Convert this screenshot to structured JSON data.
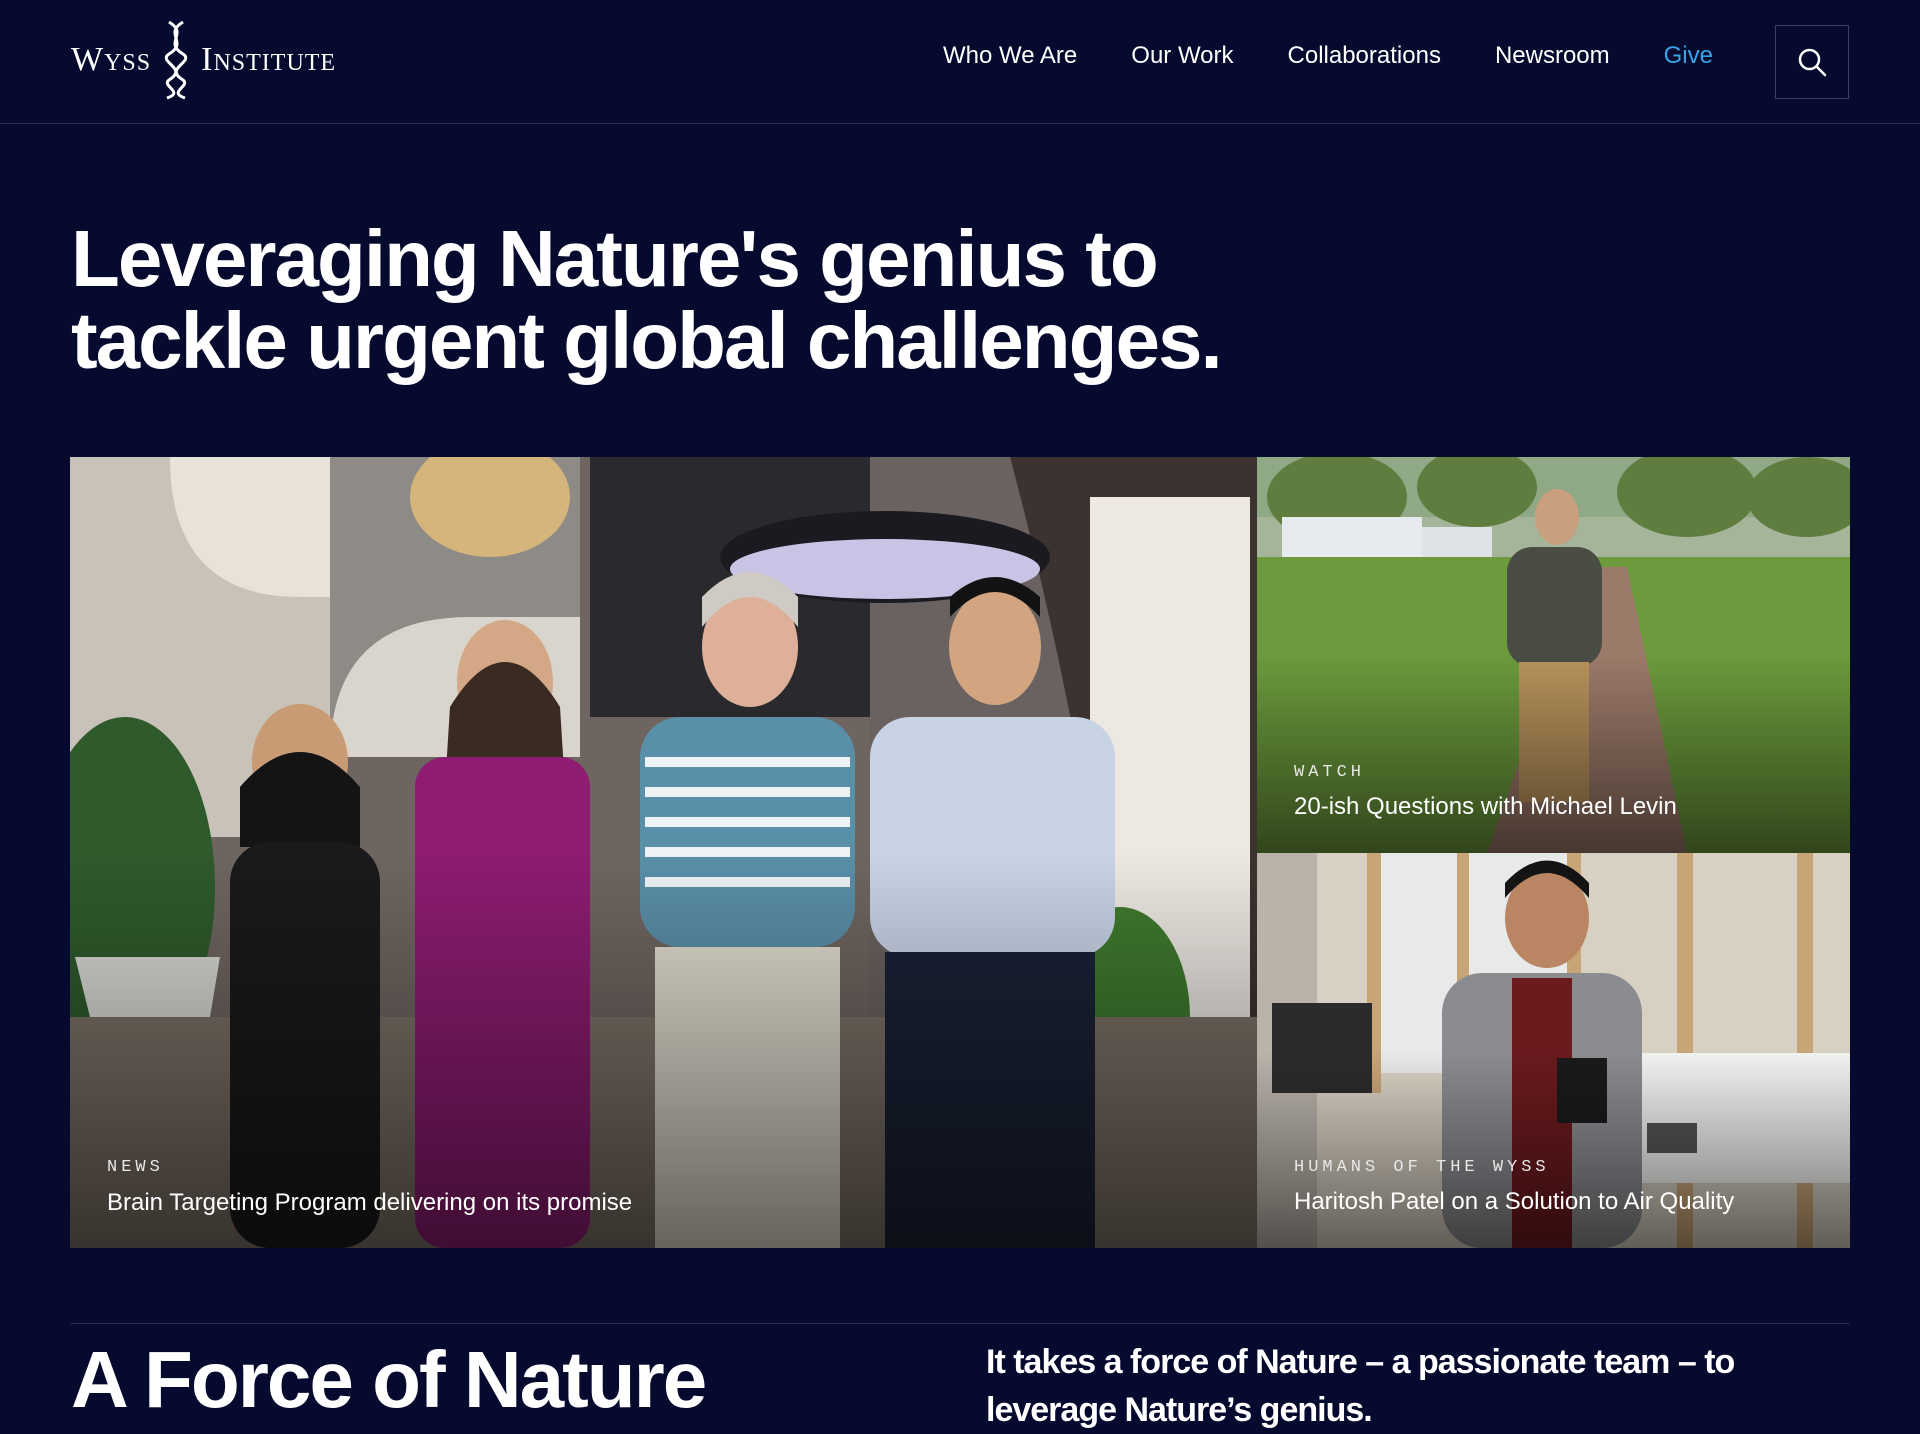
{
  "header": {
    "logo_left": "Wyss",
    "logo_right": "Institute",
    "nav": [
      {
        "label": "Who We Are"
      },
      {
        "label": "Our Work"
      },
      {
        "label": "Collaborations"
      },
      {
        "label": "Newsroom"
      },
      {
        "label": "Give"
      }
    ],
    "search_icon": "search-icon"
  },
  "hero": {
    "title": "Leveraging Nature's genius to tackle urgent global challenges."
  },
  "features": {
    "main": {
      "kicker": "NEWS",
      "title": "Brain Targeting Program delivering on its promise"
    },
    "watch": {
      "kicker": "WATCH",
      "title": "20-ish Questions with Michael Levin"
    },
    "humans": {
      "kicker": "HUMANS OF THE WYSS",
      "title": "Haritosh Patel on a Solution to Air Quality"
    }
  },
  "force": {
    "title": "A Force of Nature",
    "text": "It takes a force of Nature – a passionate team – to leverage Nature’s genius."
  },
  "colors": {
    "background": "#050a2e",
    "accent": "#39a3e8"
  }
}
